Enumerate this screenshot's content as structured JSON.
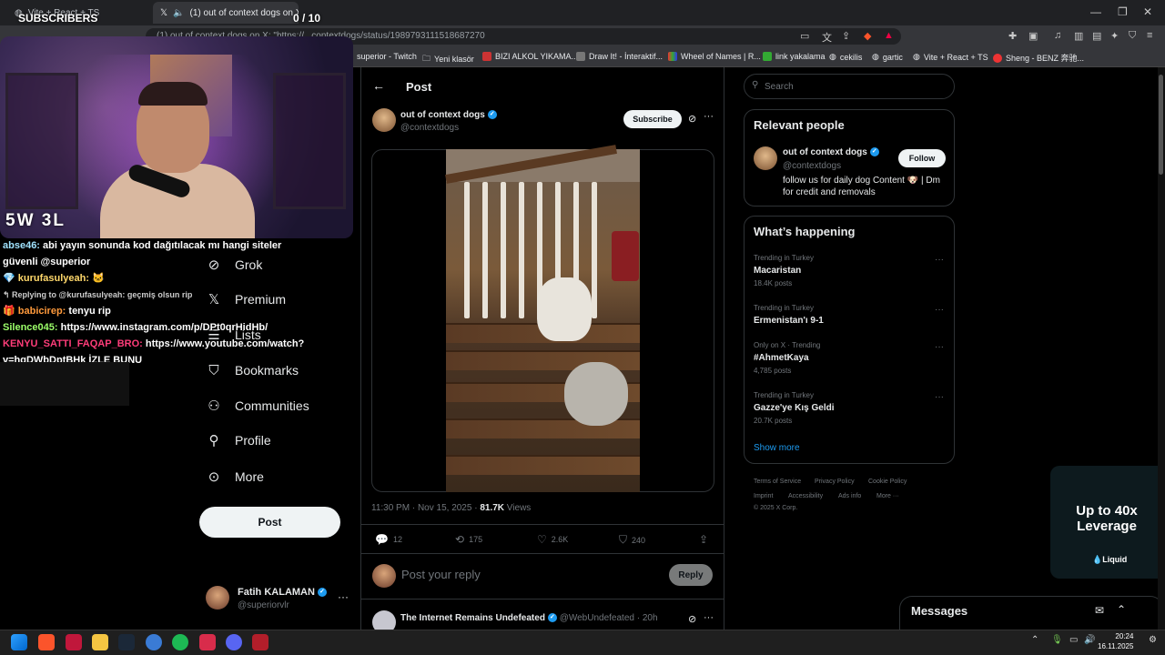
{
  "browser": {
    "tabs": [
      {
        "label": "Vite + React + TS"
      },
      {
        "label": "(1) out of context dogs on X"
      }
    ],
    "new_tab_icon": "plus-icon",
    "url": "(1) out of context dogs on X: \"https://...contextdogs/status/1989793111518687270",
    "bookmarks": [
      "superior - Twitch",
      "Yeni klasör",
      "BIZI ALKOL YIKAMA...",
      "Draw It! - İnteraktif...",
      "Wheel of Names | R...",
      "link yakalama",
      "cekilis",
      "gartic",
      "Vite + React + TS",
      "Sheng - BENZ 奔驰..."
    ]
  },
  "stream": {
    "subscribers_label": "SUBSCRIBERS",
    "subscribers_count": "0 / 10",
    "cam_logo": "5W 3L",
    "chat": [
      {
        "user": "abse46:",
        "text": "abi yayın sonunda kod dağıtılacak mı hangi siteler güvenli @superior"
      },
      {
        "user": "kurufasulyeah:",
        "text": ""
      },
      {
        "reply": "Replying to @kurufasulyeah: geçmiş olsun rip"
      },
      {
        "user": "babicirep:",
        "text": "tenyu rip"
      },
      {
        "user": "Silence045:",
        "text": "https://www.instagram.com/p/DPt0qrHidHb/"
      },
      {
        "user": "KENYU_SATTI_FAQAP_BRO:",
        "text": "https://www.youtube.com/watch?v=hgDWbDptBHk İZLE BUNU"
      }
    ]
  },
  "nav": {
    "items": [
      {
        "label": "Grok",
        "icon": "grok-icon"
      },
      {
        "label": "Premium",
        "icon": "x-logo-icon"
      },
      {
        "label": "Lists",
        "icon": "lists-icon"
      },
      {
        "label": "Bookmarks",
        "icon": "bookmark-icon"
      },
      {
        "label": "Communities",
        "icon": "communities-icon"
      },
      {
        "label": "Profile",
        "icon": "profile-icon"
      },
      {
        "label": "More",
        "icon": "more-circle-icon"
      }
    ],
    "post_button": "Post",
    "account": {
      "name": "Fatih KALAMAN",
      "handle": "@superiorvlr"
    }
  },
  "post": {
    "header": "Post",
    "author_name": "out of context dogs",
    "author_handle": "@contextdogs",
    "subscribe": "Subscribe",
    "time": "11:30 PM · Nov 15, 2025 ·",
    "views_count": "81.7K",
    "views_label": "Views",
    "replies": "12",
    "reposts": "175",
    "likes": "2.6K",
    "bookmarks": "240",
    "reply_placeholder": "Post your reply",
    "reply_button": "Reply",
    "next_author": "The Internet Remains Undefeated",
    "next_handle": "@WebUndefeated · 20h"
  },
  "right": {
    "search_placeholder": "Search",
    "relevant_title": "Relevant people",
    "relevant": {
      "name": "out of context dogs",
      "handle": "@contextdogs",
      "bio": "follow us for daily dog Content 🐶 | Dm for credit and removals",
      "follow": "Follow"
    },
    "trending_title": "What’s happening",
    "trends": [
      {
        "context": "Trending in Turkey",
        "name": "Macaristan",
        "count": "18.4K posts"
      },
      {
        "context": "Trending in Turkey",
        "name": "Ermenistan'ı 9-1",
        "count": ""
      },
      {
        "context": "Only on X · Trending",
        "name": "#AhmetKaya",
        "count": "4,785 posts"
      },
      {
        "context": "Trending in Turkey",
        "name": "Gazze'ye Kış Geldi",
        "count": "20.7K posts"
      }
    ],
    "show_more": "Show more",
    "footer": [
      "Terms of Service",
      "Privacy Policy",
      "Cookie Policy",
      "Imprint",
      "Accessibility",
      "Ads info",
      "More ···",
      "© 2025 X Corp."
    ]
  },
  "ad": {
    "text": "Up to 40x Leverage",
    "brand": "Liquid"
  },
  "messages": {
    "title": "Messages"
  },
  "taskbar": {
    "time": "20:24",
    "date": "16.11.2025"
  }
}
